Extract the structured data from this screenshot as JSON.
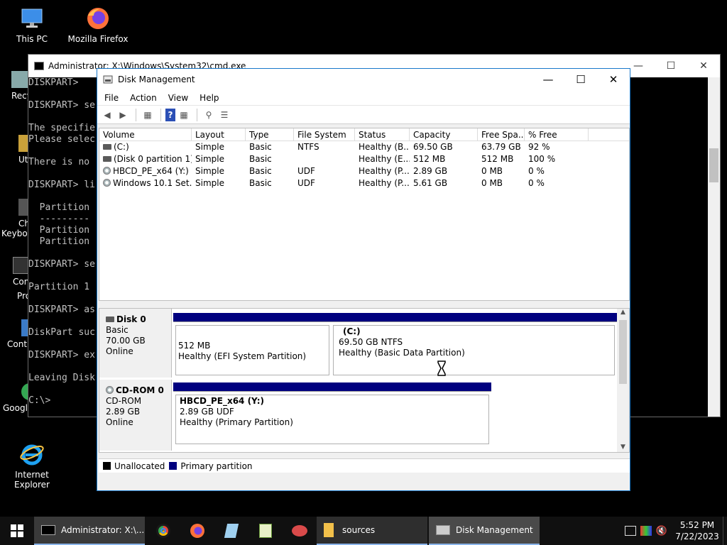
{
  "desktop": {
    "icons": [
      {
        "label": "This PC"
      },
      {
        "label": "Mozilla Firefox"
      },
      {
        "label": "Internet Explorer"
      }
    ],
    "partial_labels": [
      "Recy",
      "Ut",
      "Ch",
      "Keyboa",
      "Con",
      "Pro",
      "Contr",
      "Googl"
    ]
  },
  "cmd": {
    "title": "Administrator: X:\\Windows\\System32\\cmd.exe",
    "lines": [
      "DISKPART>",
      "",
      "DISKPART> se",
      "",
      "The specifie",
      "Please selec",
      "",
      "There is no",
      "",
      "DISKPART> li",
      "",
      "  Partition",
      "  ---------",
      "  Partition",
      "  Partition",
      "",
      "DISKPART> se",
      "",
      "Partition 1",
      "",
      "DISKPART> as",
      "",
      "DiskPart suc",
      "",
      "DISKPART> ex",
      "",
      "Leaving Disk",
      "",
      "C:\\>"
    ]
  },
  "dm": {
    "title": "Disk Management",
    "menu": [
      "File",
      "Action",
      "View",
      "Help"
    ],
    "columns": [
      "Volume",
      "Layout",
      "Type",
      "File System",
      "Status",
      "Capacity",
      "Free Spa...",
      "% Free"
    ],
    "volumes": [
      {
        "icon": "drive",
        "volume": "(C:)",
        "layout": "Simple",
        "type": "Basic",
        "fs": "NTFS",
        "status": "Healthy (B...",
        "capacity": "69.50 GB",
        "free": "63.79 GB",
        "pct": "92 %"
      },
      {
        "icon": "drive",
        "volume": "(Disk 0 partition 1)",
        "layout": "Simple",
        "type": "Basic",
        "fs": "",
        "status": "Healthy (E...",
        "capacity": "512 MB",
        "free": "512 MB",
        "pct": "100 %"
      },
      {
        "icon": "cd",
        "volume": "HBCD_PE_x64 (Y:)",
        "layout": "Simple",
        "type": "Basic",
        "fs": "UDF",
        "status": "Healthy (P...",
        "capacity": "2.89 GB",
        "free": "0 MB",
        "pct": "0 %"
      },
      {
        "icon": "cd",
        "volume": "Windows 10.1 Set...",
        "layout": "Simple",
        "type": "Basic",
        "fs": "UDF",
        "status": "Healthy (P...",
        "capacity": "5.61 GB",
        "free": "0 MB",
        "pct": "0 %"
      }
    ],
    "disks": [
      {
        "name": "Disk 0",
        "kind": "Basic",
        "size": "70.00 GB",
        "state": "Online",
        "partitions": [
          {
            "title": "",
            "size": "512 MB",
            "status": "Healthy (EFI System Partition)"
          },
          {
            "title": "(C:)",
            "size": "69.50 GB NTFS",
            "status": "Healthy (Basic Data Partition)"
          }
        ]
      },
      {
        "name": "CD-ROM 0",
        "kind": "CD-ROM",
        "size": "2.89 GB",
        "state": "Online",
        "partitions": [
          {
            "title": "HBCD_PE_x64  (Y:)",
            "size": "2.89 GB UDF",
            "status": "Healthy (Primary Partition)"
          }
        ]
      }
    ],
    "legend": [
      {
        "label": "Unallocated",
        "color": "#000000"
      },
      {
        "label": "Primary partition",
        "color": "#00007f"
      }
    ]
  },
  "taskbar": {
    "apps": [
      {
        "label": "Administrator: X:\\..."
      },
      {
        "label": "sources"
      },
      {
        "label": "Disk Management"
      }
    ],
    "time": "5:52 PM",
    "date": "7/22/2023"
  }
}
